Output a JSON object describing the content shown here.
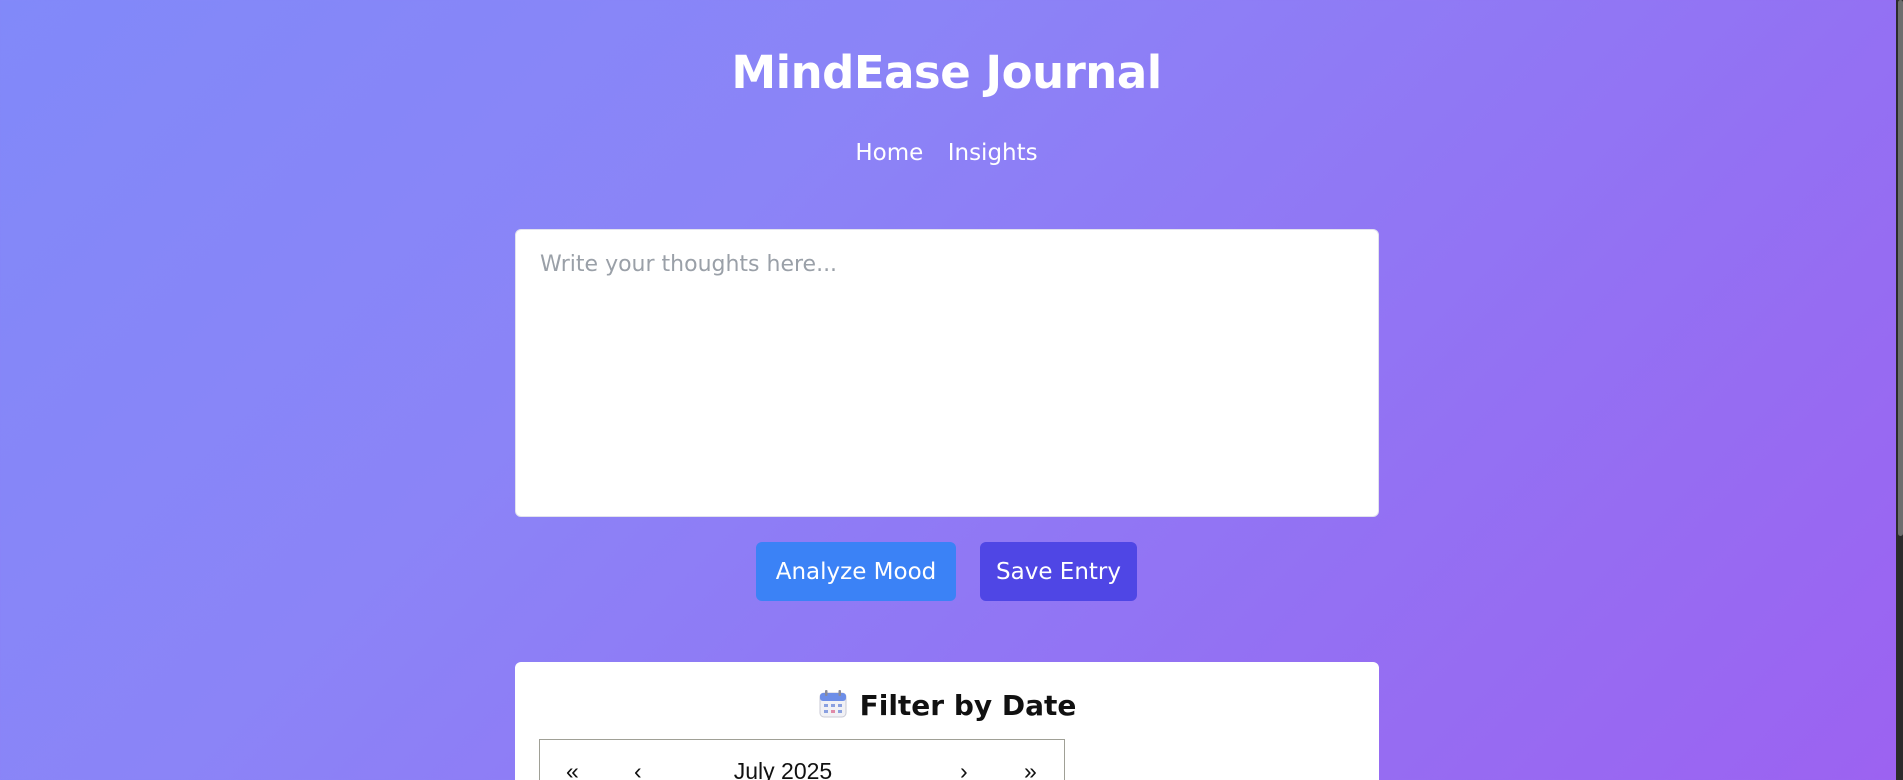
{
  "app": {
    "title": "MindEase Journal"
  },
  "nav": {
    "items": [
      {
        "label": "Home"
      },
      {
        "label": "Insights"
      }
    ]
  },
  "journal": {
    "placeholder": "Write your thoughts here...",
    "value": ""
  },
  "actions": {
    "analyze_label": "Analyze Mood",
    "save_label": "Save Entry"
  },
  "filter": {
    "heading": "Filter by Date",
    "icon": "calendar-icon",
    "calendar": {
      "prev_year": "«",
      "prev_month": "‹",
      "month_label": "July 2025",
      "next_month": "›",
      "next_year": "»"
    }
  },
  "colors": {
    "background_start": "#8189f9",
    "background_end": "#9c62f1",
    "analyze_button": "#3b82f6",
    "save_button": "#4f46e5"
  }
}
